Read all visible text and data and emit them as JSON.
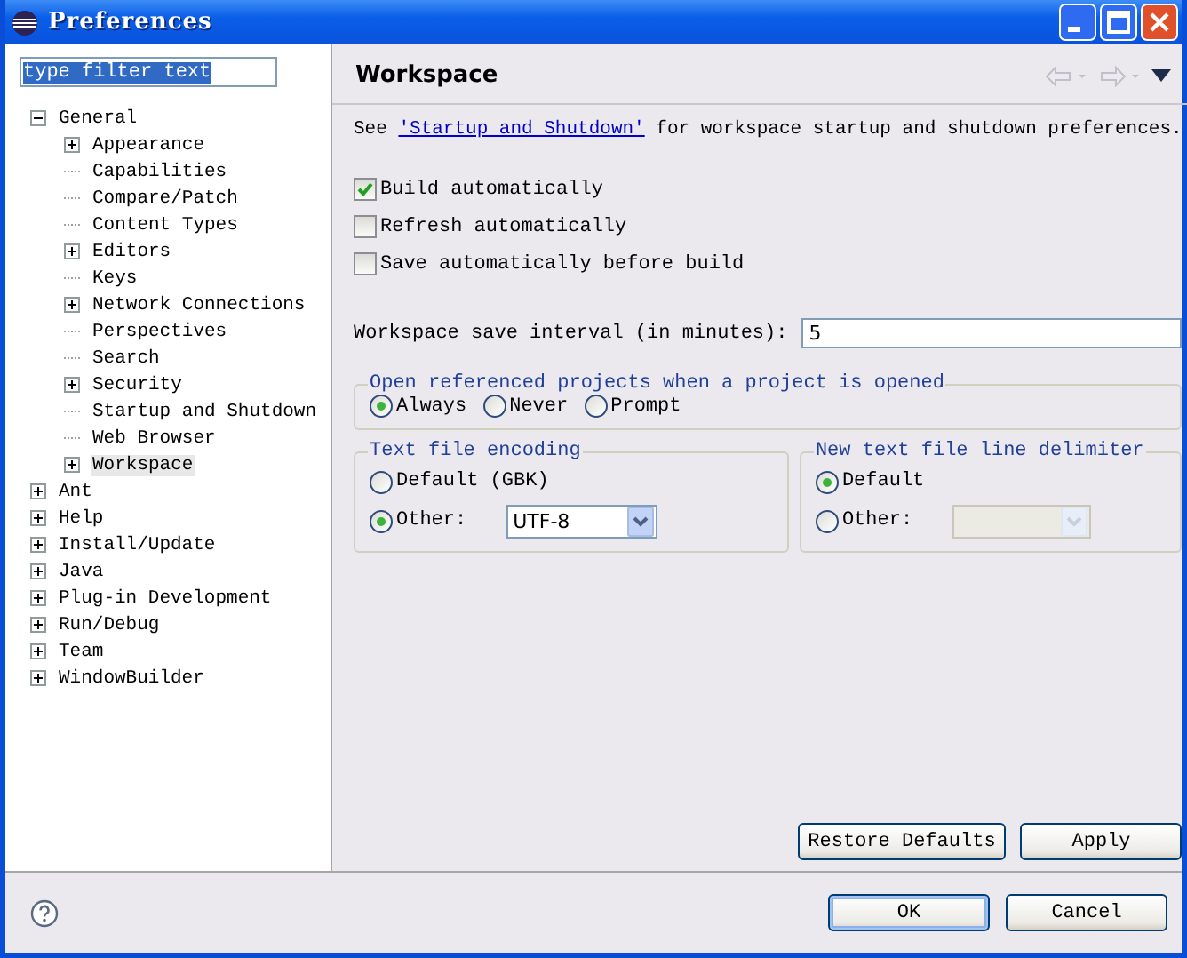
{
  "window": {
    "title": "Preferences"
  },
  "filter": {
    "value": "type filter text",
    "text_selected": true
  },
  "tree": [
    {
      "label": "General",
      "expanded": true,
      "selected": false,
      "children": [
        {
          "label": "Appearance",
          "expanded": false,
          "selected": false
        },
        {
          "label": "Capabilities",
          "selected": false
        },
        {
          "label": "Compare/Patch",
          "selected": false
        },
        {
          "label": "Content Types",
          "selected": false
        },
        {
          "label": "Editors",
          "expanded": false,
          "selected": false
        },
        {
          "label": "Keys",
          "selected": false
        },
        {
          "label": "Network Connections",
          "expanded": false,
          "selected": false
        },
        {
          "label": "Perspectives",
          "selected": false
        },
        {
          "label": "Search",
          "selected": false
        },
        {
          "label": "Security",
          "expanded": false,
          "selected": false
        },
        {
          "label": "Startup and Shutdown",
          "selected": false
        },
        {
          "label": "Web Browser",
          "selected": false
        },
        {
          "label": "Workspace",
          "expanded": false,
          "selected": true
        }
      ]
    },
    {
      "label": "Ant",
      "expanded": false,
      "selected": false
    },
    {
      "label": "Help",
      "expanded": false,
      "selected": false
    },
    {
      "label": "Install/Update",
      "expanded": false,
      "selected": false
    },
    {
      "label": "Java",
      "expanded": false,
      "selected": false
    },
    {
      "label": "Plug-in Development",
      "expanded": false,
      "selected": false
    },
    {
      "label": "Run/Debug",
      "expanded": false,
      "selected": false
    },
    {
      "label": "Team",
      "expanded": false,
      "selected": false
    },
    {
      "label": "WindowBuilder",
      "expanded": false,
      "selected": false
    }
  ],
  "page": {
    "title": "Workspace",
    "nav": {
      "back_disabled": true,
      "forward_disabled": true
    },
    "description": {
      "before": "See",
      "link": "'Startup and Shutdown'",
      "after": "for workspace startup and shutdown preferences."
    },
    "checkboxes": [
      {
        "label": "Build automatically",
        "checked": true
      },
      {
        "label": "Refresh automatically",
        "checked": false
      },
      {
        "label": "Save automatically before build",
        "checked": false
      }
    ],
    "interval": {
      "label": "Workspace save interval (in minutes):",
      "value": "5"
    },
    "open_projects": {
      "title": "Open referenced projects when a project is opened",
      "options": [
        {
          "label": "Always",
          "selected": true
        },
        {
          "label": "Never",
          "selected": false
        },
        {
          "label": "Prompt",
          "selected": false
        }
      ]
    },
    "encoding": {
      "title": "Text file encoding",
      "options": [
        {
          "label": "Default (GBK)",
          "selected": false
        },
        {
          "label": "Other:",
          "selected": true,
          "combo": {
            "value": "UTF-8",
            "disabled": false
          }
        }
      ]
    },
    "delimiter": {
      "title": "New text file line delimiter",
      "options": [
        {
          "label": "Default",
          "selected": true
        },
        {
          "label": "Other:",
          "selected": false,
          "combo": {
            "disabled": true
          }
        }
      ]
    },
    "buttons": [
      "Restore Defaults",
      "Apply"
    ]
  },
  "dialog_buttons": [
    {
      "label": "OK",
      "default": true
    },
    {
      "label": "Cancel",
      "default": false
    }
  ]
}
